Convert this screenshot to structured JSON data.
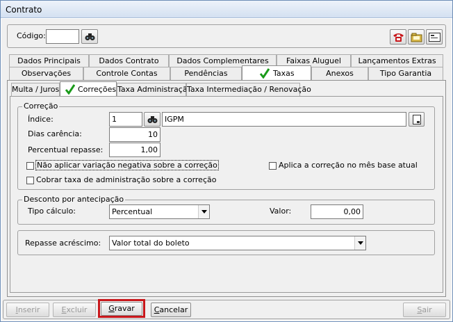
{
  "window": {
    "title": "Contrato"
  },
  "header": {
    "codigo_label": "Código:",
    "codigo_value": ""
  },
  "tabs_row1": [
    "Dados Principais",
    "Dados Contrato",
    "Dados Complementares",
    "Faixas Aluguel",
    "Lançamentos Extras"
  ],
  "tabs_row2": [
    "Observações",
    "Controle Contas",
    "Pendências",
    "Taxas",
    "Anexos",
    "Tipo Garantia"
  ],
  "subtabs": [
    "Multa / Juros",
    "Correções",
    "Taxa Administração",
    "Taxa Intermediação / Renovação"
  ],
  "correcao": {
    "legend": "Correção",
    "indice_label": "Índice:",
    "indice_code": "1",
    "indice_name": "IGPM",
    "dias_label": "Dias carência:",
    "dias_value": "10",
    "percentual_label": "Percentual repasse:",
    "percentual_value": "1,00",
    "check_neg_label": "Não aplicar variação negativa sobre a correção",
    "check_neg_checked": false,
    "check_base_label": "Aplica a correção no mês base atual",
    "check_base_checked": false,
    "check_taxa_label": "Cobrar taxa de administração sobre a correção",
    "check_taxa_checked": false
  },
  "desconto": {
    "legend": "Desconto por antecipação",
    "tipo_label": "Tipo cálculo:",
    "tipo_value": "Percentual",
    "valor_label": "Valor:",
    "valor_value": "0,00"
  },
  "repasse": {
    "label": "Repasse acréscimo:",
    "value": "Valor total do boleto"
  },
  "buttons": {
    "inserir_first": "I",
    "inserir_rest": "nserir",
    "excluir_first": "E",
    "excluir_rest": "xcluir",
    "gravar_first": "G",
    "gravar_rest": "ravar",
    "cancelar_first": "C",
    "cancelar_rest": "ancelar",
    "sair_first": "S",
    "sair_rest": "air"
  },
  "colors": {
    "highlight": "#c8171b",
    "check": "#1a9a1a"
  }
}
